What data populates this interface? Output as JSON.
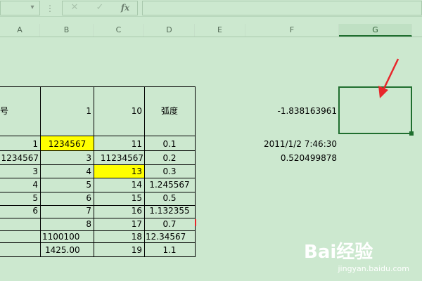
{
  "formula_bar": {
    "dropdown_icon": "▾",
    "separator_icon": "⋮",
    "cancel_icon": "✕",
    "enter_icon": "✓",
    "fx_label": "fx",
    "formula_value": ""
  },
  "columns": [
    "A",
    "B",
    "C",
    "D",
    "E",
    "F",
    "G"
  ],
  "header_row": {
    "a": "号",
    "b": "1",
    "c": "10",
    "d": "弧度",
    "f": "-1.838163961"
  },
  "rows": [
    {
      "a": "1",
      "b": "1234567",
      "c": "11",
      "d": "0.1",
      "f": "2011/1/2 7:46:30"
    },
    {
      "a": "1234567",
      "b": "3",
      "c": "11234567",
      "d": "0.2",
      "f": "0.520499878"
    },
    {
      "a": "3",
      "b": "4",
      "c": "13",
      "d": "0.3",
      "f": ""
    },
    {
      "a": "4",
      "b": "5",
      "c": "14",
      "d": "1.245567",
      "f": ""
    },
    {
      "a": "5",
      "b": "6",
      "c": "15",
      "d": "0.5",
      "f": ""
    },
    {
      "a": "6",
      "b": "7",
      "c": "16",
      "d": "1.132355",
      "f": ""
    },
    {
      "a": "",
      "b": "8",
      "c": "17",
      "d": "0.7",
      "f": ""
    },
    {
      "a": "",
      "b": "1100100",
      "c": "18",
      "d": "12.34567",
      "f": ""
    },
    {
      "a": "",
      "b": "1425.00",
      "c": "19",
      "d": "1.1",
      "f": ""
    }
  ],
  "colors": {
    "sheet_bg": "#cce8cf",
    "highlight": "#ffff00",
    "selection": "#1f6e2f",
    "arrow": "#e8262b"
  },
  "watermark": {
    "brand": "Bai经验",
    "url": "jingyan.baidu.com"
  }
}
